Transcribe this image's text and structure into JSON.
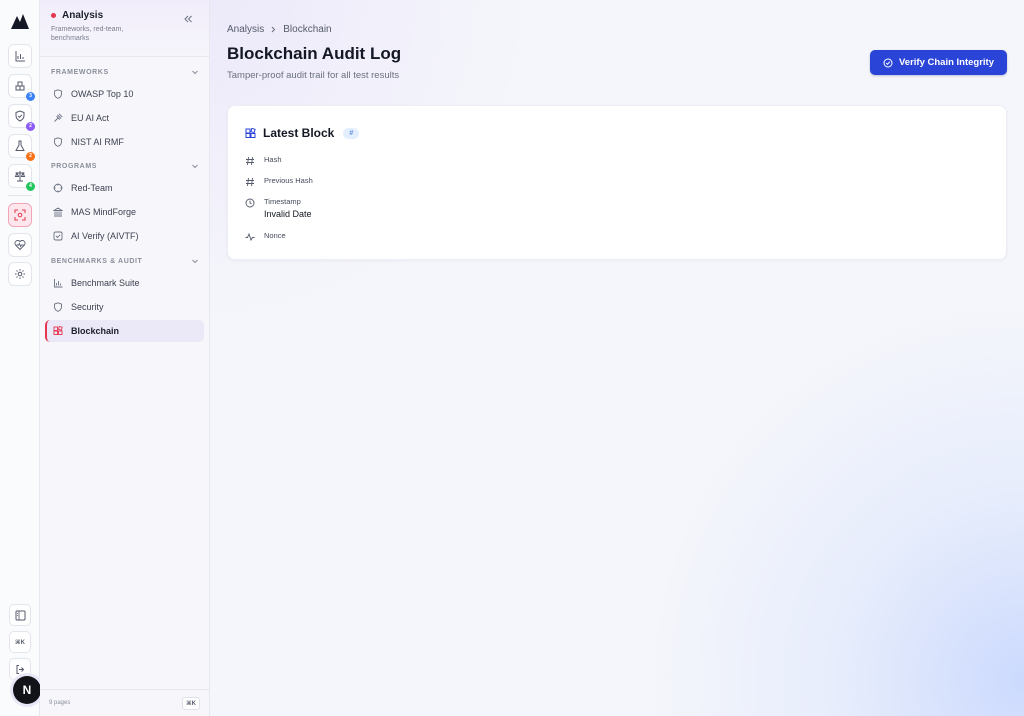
{
  "rail": {
    "badges": [
      "3",
      "2",
      "2",
      "4"
    ],
    "badge_colors": [
      "#3b82f6",
      "#8b5cf6",
      "#f97316",
      "#22c55e"
    ],
    "shortcut": "⌘K",
    "avatar_letter": "N"
  },
  "sidebar": {
    "title": "Analysis",
    "subtitle": "Frameworks, red-team, benchmarks",
    "sections": [
      {
        "label": "FRAMEWORKS",
        "items": [
          {
            "label": "OWASP Top 10",
            "icon": "shield-icon"
          },
          {
            "label": "EU AI Act",
            "icon": "gavel-icon"
          },
          {
            "label": "NIST AI RMF",
            "icon": "shield-icon"
          }
        ]
      },
      {
        "label": "PROGRAMS",
        "items": [
          {
            "label": "Red-Team",
            "icon": "crosshair-icon"
          },
          {
            "label": "MAS MindForge",
            "icon": "bank-icon"
          },
          {
            "label": "AI Verify (AIVTF)",
            "icon": "check-square-icon"
          }
        ]
      },
      {
        "label": "BENCHMARKS & AUDIT",
        "items": [
          {
            "label": "Benchmark Suite",
            "icon": "bar-chart-icon"
          },
          {
            "label": "Security",
            "icon": "shield-icon"
          },
          {
            "label": "Blockchain",
            "icon": "blocks-icon"
          }
        ]
      }
    ],
    "footer_pages": "9 pages",
    "footer_shortcut": "⌘K"
  },
  "breadcrumb": {
    "parent": "Analysis",
    "current": "Blockchain"
  },
  "header": {
    "title": "Blockchain Audit Log",
    "subtitle": "Tamper-proof audit trail for all test results",
    "verify_label": "Verify Chain Integrity"
  },
  "card": {
    "title": "Latest Block",
    "pill": "#",
    "fields": [
      {
        "label": "Hash",
        "value": "",
        "icon": "hash-icon"
      },
      {
        "label": "Previous Hash",
        "value": "",
        "icon": "hash-icon"
      },
      {
        "label": "Timestamp",
        "value": "Invalid Date",
        "icon": "clock-icon"
      },
      {
        "label": "Nonce",
        "value": "",
        "icon": "activity-icon"
      }
    ]
  },
  "colors": {
    "accent": "#2a44d8",
    "active_marker": "#e5344e",
    "active_bg": "#ebe8f8"
  }
}
